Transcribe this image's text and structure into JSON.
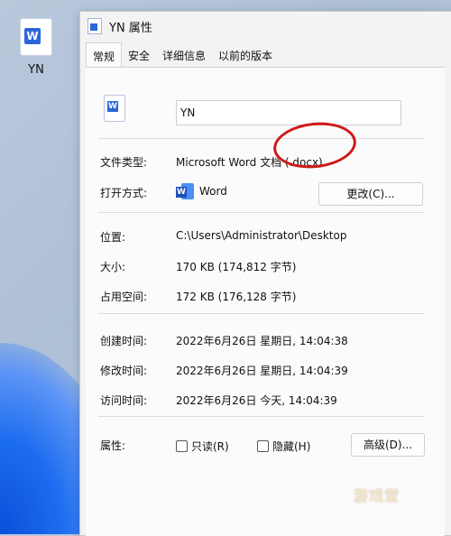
{
  "desktop": {
    "icon_label": "YN"
  },
  "window": {
    "title": "YN 属性",
    "tabs": [
      "常规",
      "安全",
      "详细信息",
      "以前的版本"
    ],
    "filename": "YN",
    "file_type_label": "文件类型:",
    "file_type_value": "Microsoft Word 文档 (.docx)",
    "open_with_label": "打开方式:",
    "open_with_value": "Word",
    "change_button": "更改(C)...",
    "location_label": "位置:",
    "location_value": "C:\\Users\\Administrator\\Desktop",
    "size_label": "大小:",
    "size_value": "170 KB (174,812 字节)",
    "size_on_disk_label": "占用空间:",
    "size_on_disk_value": "172 KB (176,128 字节)",
    "created_label": "创建时间:",
    "created_value": "2022年6月26日 星期日, 14:04:38",
    "modified_label": "修改时间:",
    "modified_value": "2022年6月26日 星期日, 14:04:39",
    "accessed_label": "访问时间:",
    "accessed_value": "2022年6月26日 今天, 14:04:39",
    "attributes_label": "属性:",
    "readonly_label": "只读(R)",
    "hidden_label": "隐藏(H)",
    "advanced_button": "高级(D)..."
  },
  "watermark": "游戏堂"
}
